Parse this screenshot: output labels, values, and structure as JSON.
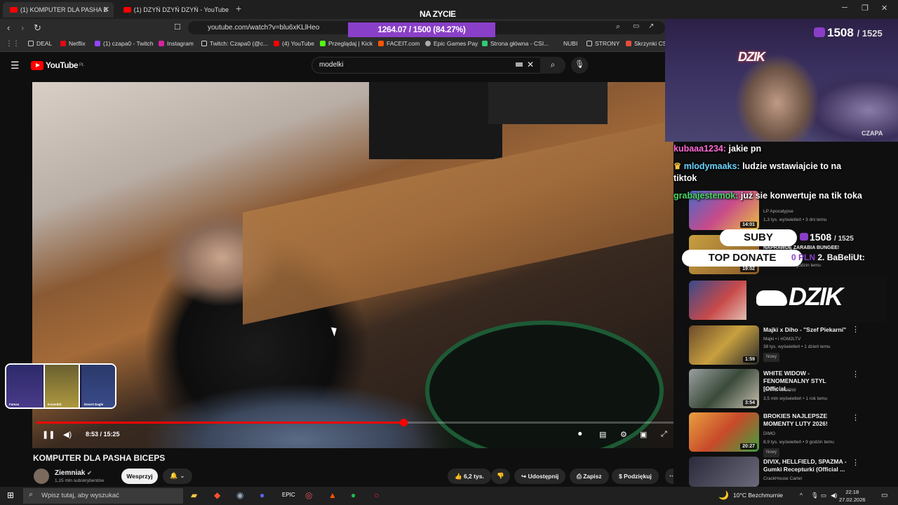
{
  "browser": {
    "tabs": [
      {
        "label": "(1) KOMPUTER DLA PASHA B"
      },
      {
        "label": "(1) DZYŃ DZYŃ DZYŃ - YouTube"
      }
    ],
    "url": "youtube.com/watch?v=blu6xKLlHeo",
    "bookmarks": [
      "DEAL",
      "Netflix",
      "(1) czapa0 - Twitch",
      "Instagram",
      "Twitch: Czapa0 (@c...",
      "(4) YouTube",
      "Przeglądaj | Kick",
      "FACEIT.com",
      "Epic Games Pay",
      "Strona główna - CSI...",
      "NUBI",
      "STRONY",
      "Skrzynki CSx"
    ]
  },
  "youtube": {
    "logo": "YouTube",
    "region": "PL",
    "search_value": "modelki",
    "video": {
      "time": "8:53 / 15:25",
      "progress": 0.576,
      "title": "KOMPUTER DLA PASHA BICEPS",
      "channel": "Ziemniak",
      "subscribers": "1,15 mln subskrybentów",
      "support_label": "Wesprzyj",
      "likes": "6,2 tys.",
      "share": "Udostępnij",
      "save": "Zapisz",
      "thanks": "Podziękuj"
    },
    "sidebar": [
      {
        "title": "",
        "channel": "LP Apocalypse",
        "meta": "1,3 tys. wyświetleń • 3 dni temu",
        "duration": "14:01",
        "badge": "Nowy"
      },
      {
        "title": "NAPRAWDĘ ZARABIA BUNGEE!",
        "channel": "",
        "meta": "• 6 godzin temu",
        "duration": "19:02",
        "badge": "Nowy"
      },
      {
        "title": "Majki x Diho - \"Szef Piekarni\"",
        "channel": "Majki • i #GM2LTV",
        "meta": "38 tys. wyświetleń • 1 dzień temu",
        "duration": "1:59",
        "badge": "Nowy"
      },
      {
        "title": "WHITE WIDOW - FENOMENALNY STYL [Official...",
        "channel": "WHITE WIDOW",
        "meta": "3,5 mln wyświetleń • 1 rok temu",
        "duration": "3:54",
        "badge": ""
      },
      {
        "title": "BROKIES NAJLEPSZE MOMENTY LUTY 2026!",
        "channel": "DIMO",
        "meta": "8,9 tys. wyświetleń • 9 godzin temu",
        "duration": "20:27",
        "badge": "Nowy"
      },
      {
        "title": "DIVIX, HELLFIELD, SPAZMA - Gumki Recepturki (Official ...",
        "channel": "CrackHouse Cartel",
        "meta": "",
        "duration": "",
        "badge": ""
      }
    ]
  },
  "stream": {
    "status": "NA ZYCIE",
    "goal": "1264.07 / 1500 (84.27%)",
    "sub_count": "1508",
    "sub_goal": "/ 1525",
    "brand": "DZIK",
    "streamer": "CZAPA",
    "suby_label": "SUBY",
    "top_donate_label": "TOP DONATE",
    "donate_text": "0 PLN",
    "donate_second": "2. BaBeliUt:",
    "chat": [
      {
        "user": "kubaaa1234:",
        "text": "jakie pn"
      },
      {
        "user": "mlodymaaks:",
        "text": "ludzie wstawiajcie to na"
      },
      {
        "user": "",
        "text": "tiktok"
      },
      {
        "user": "grabajestemok:",
        "text": "już sie konwertuje na tik toka"
      }
    ],
    "case_items": [
      "Famas",
      "Karambit",
      "Desert Eagle"
    ]
  },
  "taskbar": {
    "search_placeholder": "Wpisz tutaj, aby wyszukać",
    "weather": "10°C Bezchmurnie",
    "time": "22:18",
    "date": "27.02.2026"
  }
}
